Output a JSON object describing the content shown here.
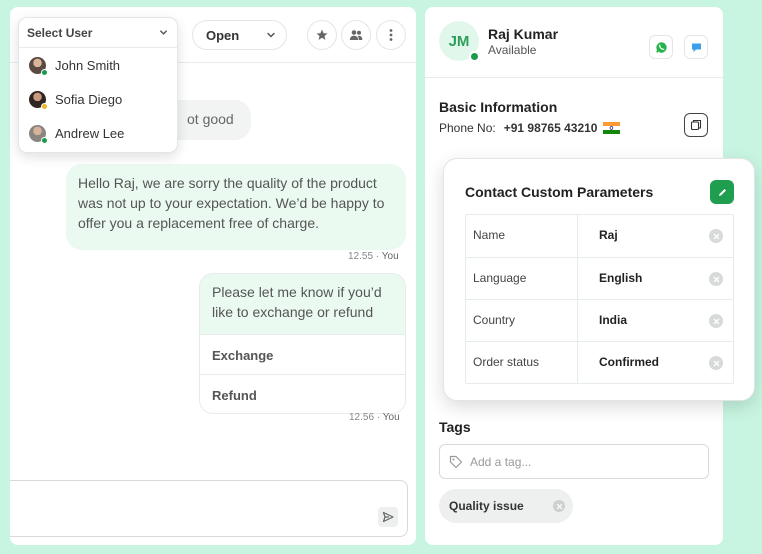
{
  "header": {
    "status_value": "Open"
  },
  "user_dropdown": {
    "placeholder": "Select User",
    "users": [
      {
        "name": "John Smith",
        "status_color": "#1a9b4c"
      },
      {
        "name": "Sofia Diego",
        "status_color": "#f0b429"
      },
      {
        "name": "Andrew Lee",
        "status_color": "#1a9b4c"
      }
    ]
  },
  "messages": {
    "incoming_partial": "ot good",
    "outgoing_text": "Hello Raj, we are sorry the quality of the product was not up to your expectation. We’d be happy to offer you a replacement free of charge.",
    "outgoing_time": "12.55",
    "outgoing_sender": "You",
    "card_text": "Please let me know if you’d like to exchange or refund",
    "card_options": [
      "Exchange",
      "Refund"
    ],
    "card_time": "12.56",
    "card_sender": "You"
  },
  "contact": {
    "initials": "JM",
    "name": "Raj Kumar",
    "status": "Available",
    "basic_info_title": "Basic Information",
    "phone_label": "Phone No:",
    "phone_number": "+91 98765 43210"
  },
  "custom_params": {
    "title": "Contact Custom Parameters",
    "rows": [
      {
        "key": "Name",
        "value": "Raj"
      },
      {
        "key": "Language",
        "value": "English"
      },
      {
        "key": "Country",
        "value": "India"
      },
      {
        "key": "Order status",
        "value": "Confirmed"
      }
    ]
  },
  "tags": {
    "title": "Tags",
    "input_placeholder": "Add a tag...",
    "items": [
      "Quality issue"
    ]
  },
  "colors": {
    "background": "#c8f5e2",
    "accent_green": "#1e9e4e",
    "outgoing_bubble": "#eafaf1"
  }
}
